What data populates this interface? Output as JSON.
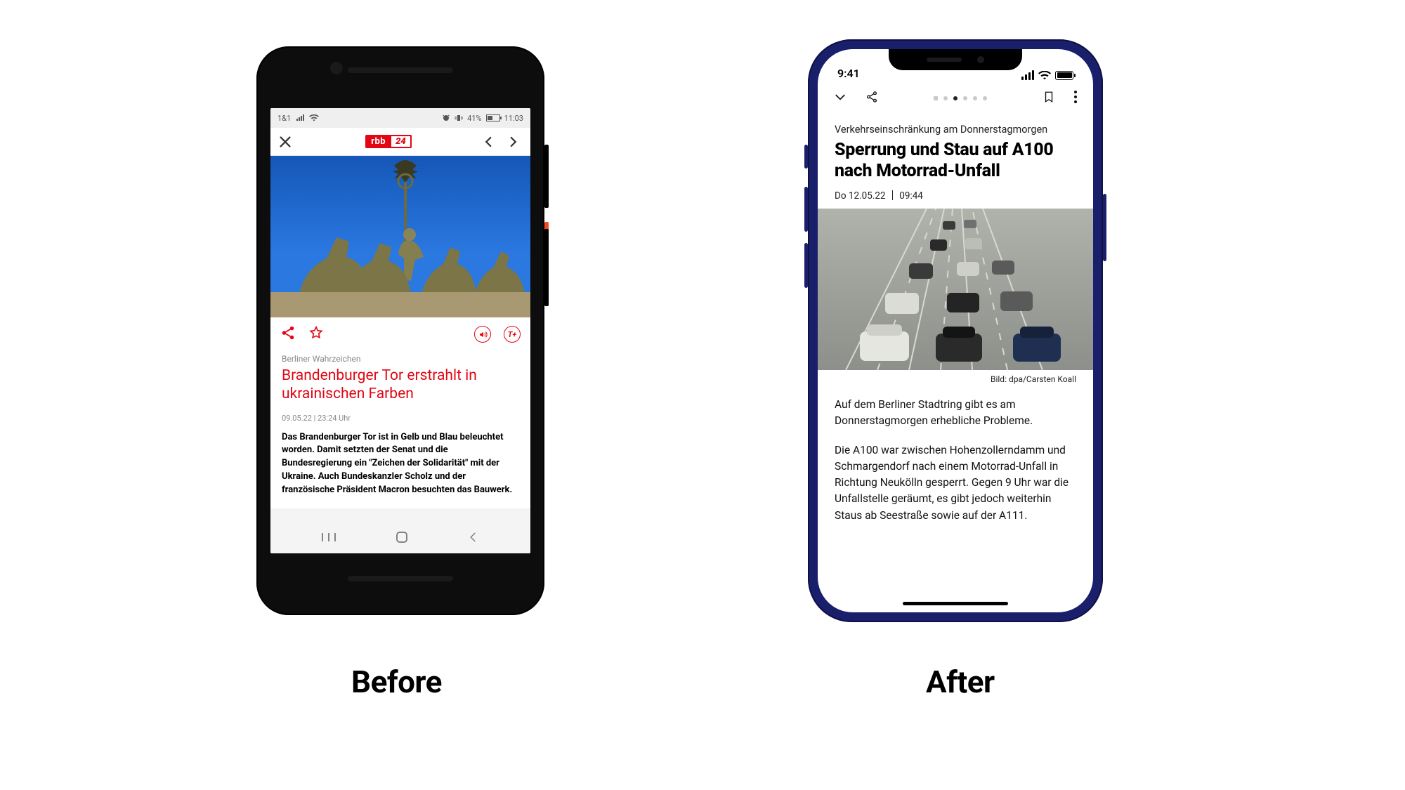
{
  "labels": {
    "before": "Before",
    "after": "After"
  },
  "before": {
    "status": {
      "carrier": "1&1",
      "batteryPct": "41%",
      "time": "11:03",
      "vibrate": "vibrate-icon"
    },
    "nav": {
      "logoMain": "rbb",
      "logoSuffix": "24"
    },
    "toolbar": {
      "textSize": "T+"
    },
    "article": {
      "kicker": "Berliner Wahrzeichen",
      "title": "Brandenburger Tor erstrahlt in ukrainischen Farben",
      "date": "09.05.22 | 23:24 Uhr",
      "lead": "Das Brandenburger Tor ist in Gelb und Blau beleuchtet worden. Damit setzten der Senat und die Bundesregierung ein \"Zeichen der Solidarität\" mit der Ukraine. Auch Bundeskanzler Scholz und der französische Präsident Macron besuchten das Bauwerk."
    }
  },
  "after": {
    "status": {
      "time": "9:41"
    },
    "paginationActive": 3,
    "article": {
      "kicker": "Verkehrseinschränkung am Donnerstagmorgen",
      "title": "Sperrung und Stau auf A100 nach Motorrad-Unfall",
      "dateDay": "Do 12.05.22",
      "dateTime": "09:44",
      "credit": "Bild: dpa/Carsten Koall",
      "p1": "Auf dem Berliner Stadtring gibt es am Donnerstagmorgen erhebliche Probleme.",
      "p2": "Die A100 war zwischen Hohenzollerndamm und Schmargendorf nach einem Motorrad-Unfall in Richtung Neukölln gesperrt. Gegen 9 Uhr war die Unfallstelle geräumt, es gibt jedoch weiterhin Staus ab Seestraße sowie auf der A111."
    }
  }
}
